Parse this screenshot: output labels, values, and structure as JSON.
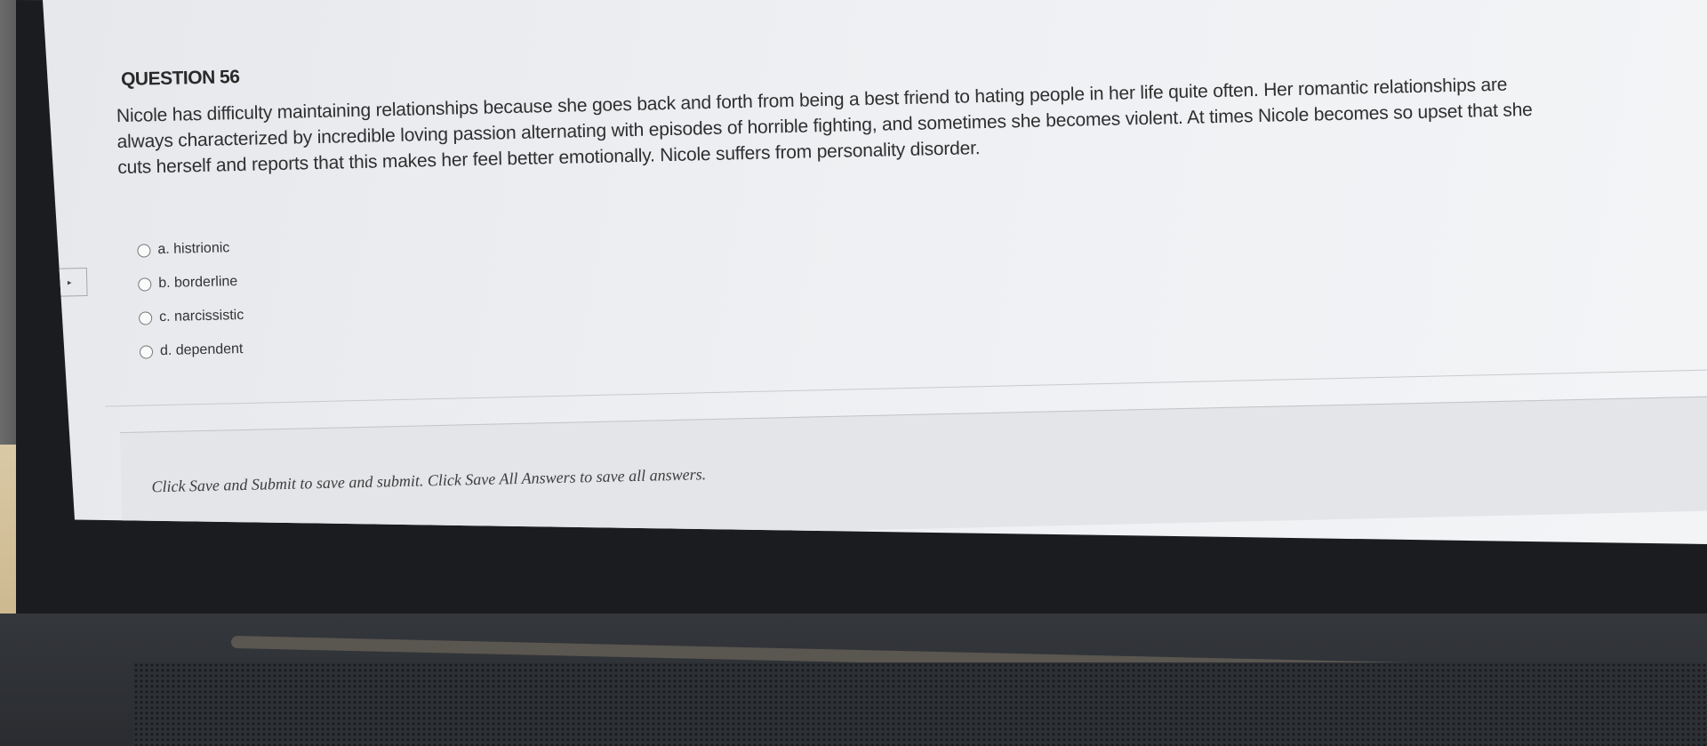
{
  "question": {
    "title": "QUESTION 56",
    "text": "Nicole has difficulty maintaining relationships because she goes back and forth from being a best friend to hating people in her life quite often. Her romantic relationships are\nalways characterized by incredible loving passion alternating with episodes of horrible fighting, and sometimes she becomes violent. At times Nicole becomes so upset that she\ncuts herself and reports that this makes her feel better emotionally. Nicole suffers from personality disorder.",
    "marker_glyph": "▸",
    "options": [
      {
        "label": "a. histrionic"
      },
      {
        "label": "b. borderline"
      },
      {
        "label": "c. narcissistic"
      },
      {
        "label": "d. dependent"
      }
    ]
  },
  "footer": {
    "instruction": "Click Save and Submit to save and submit. Click Save All Answers to save all answers."
  }
}
